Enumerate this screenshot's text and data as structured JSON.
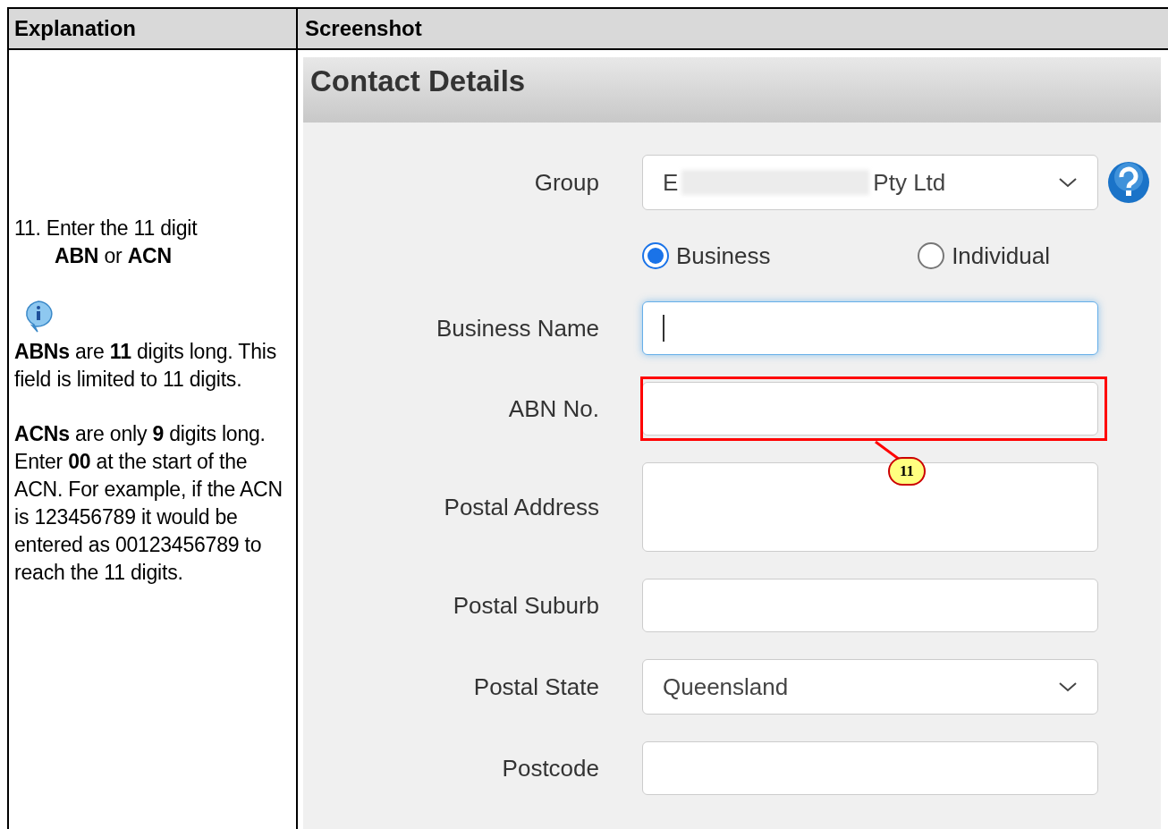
{
  "table": {
    "columns": [
      "Explanation",
      "Screenshot"
    ]
  },
  "explanation": {
    "step": "11. Enter the 11 digit",
    "step_detail": "**ABN** or **ACN**",
    "notes": [
      "**ABNs** are **11** digits long. This field is limited to 11 digits.",
      "**ACNs** are only **9** digits long. Enter **00** at the start of the ACN. For example, if the ACN is 123456789 it would be entered as 00123456789 to reach the 11 digits."
    ]
  },
  "screenshot": {
    "title": "Contact Details",
    "fields": [
      {
        "kind": "select",
        "label": "Group",
        "value_start": "E",
        "value_end": "Pty Ltd",
        "help": true
      },
      {
        "kind": "radio",
        "options": [
          {
            "label": "Business",
            "selected": true
          },
          {
            "label": "Individual",
            "selected": false
          }
        ]
      },
      {
        "kind": "text",
        "label": "Business Name",
        "focused": true
      },
      {
        "kind": "text",
        "label": "ABN No.",
        "callout": "11"
      },
      {
        "kind": "textarea",
        "label": "Postal Address"
      },
      {
        "kind": "text",
        "label": "Postal Suburb"
      },
      {
        "kind": "select",
        "label": "Postal State",
        "value_start": "Queensland"
      },
      {
        "kind": "short",
        "label": "Postcode"
      }
    ]
  }
}
